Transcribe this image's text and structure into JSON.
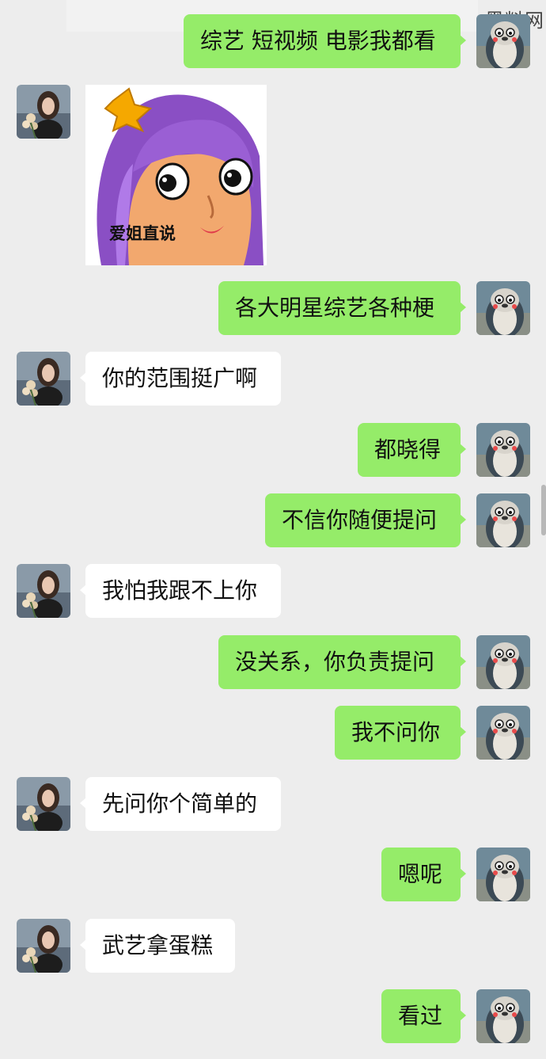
{
  "watermark": "黑料网",
  "sticker_caption": "爱姐直说",
  "messages": [
    {
      "from": "me",
      "text": "综艺 短视频 电影我都看"
    },
    {
      "from": "her",
      "type": "sticker",
      "text": "爱姐直说"
    },
    {
      "from": "me",
      "text": "各大明星综艺各种梗"
    },
    {
      "from": "her",
      "text": "你的范围挺广啊"
    },
    {
      "from": "me",
      "text": "都晓得"
    },
    {
      "from": "me",
      "text": "不信你随便提问"
    },
    {
      "from": "her",
      "text": "我怕我跟不上你"
    },
    {
      "from": "me",
      "text": "没关系，你负责提问"
    },
    {
      "from": "me",
      "text": "我不问你"
    },
    {
      "from": "her",
      "text": "先问你个简单的"
    },
    {
      "from": "me",
      "text": "嗯呢"
    },
    {
      "from": "her",
      "text": "武艺拿蛋糕"
    },
    {
      "from": "me",
      "text": "看过"
    }
  ],
  "colors": {
    "background": "#ededed",
    "outgoing_bubble": "#95ec69",
    "incoming_bubble": "#ffffff",
    "sticker_hair": "#8a4fc4",
    "sticker_bow": "#f5a800"
  },
  "icons": {
    "my_avatar": "penguin-avatar-icon",
    "her_avatar": "woman-with-flowers-avatar-icon"
  }
}
